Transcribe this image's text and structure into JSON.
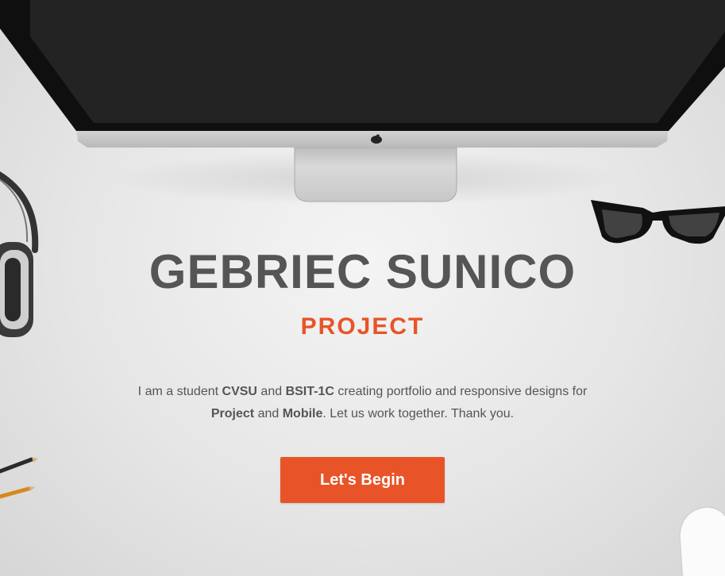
{
  "hero": {
    "name": "GEBRIEC SUNICO",
    "subtitle": "PROJECT",
    "description": {
      "part1": "I am a student ",
      "school": "CVSU",
      "part2": " and ",
      "section": "BSIT-1C",
      "part3": " creating portfolio and responsive designs for ",
      "topic1": "Project",
      "part4": " and ",
      "topic2": "Mobile",
      "part5": ". Let us work together. Thank you."
    },
    "cta_label": "Let's Begin"
  },
  "colors": {
    "accent": "#e85428",
    "heading": "#555555",
    "background": "#e6e6e6"
  },
  "decor": {
    "monitor": "imac-monitor-icon",
    "headphones": "headphones-icon",
    "glasses": "eyeglasses-icon",
    "pencils": "pencils-icon",
    "mouse": "mouse-icon"
  }
}
